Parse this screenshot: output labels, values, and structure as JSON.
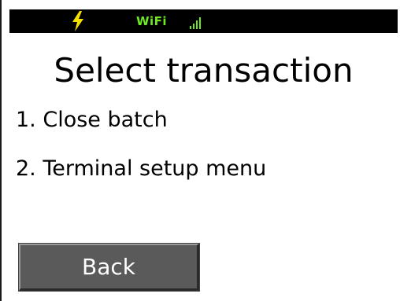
{
  "status_bar": {
    "power_icon": "lightning-bolt",
    "wifi_label": "WiFi",
    "signal_icon": "signal-bars",
    "colors": {
      "background": "#000000",
      "bolt": "#f5e000",
      "wifi": "#6ee81f"
    }
  },
  "screen": {
    "title": "Select transaction",
    "menu": [
      {
        "label": "1. Close batch"
      },
      {
        "label": "2. Terminal setup menu"
      }
    ],
    "back_label": "Back",
    "colors": {
      "button_bg": "#5a5a5a",
      "button_text": "#ffffff"
    }
  }
}
